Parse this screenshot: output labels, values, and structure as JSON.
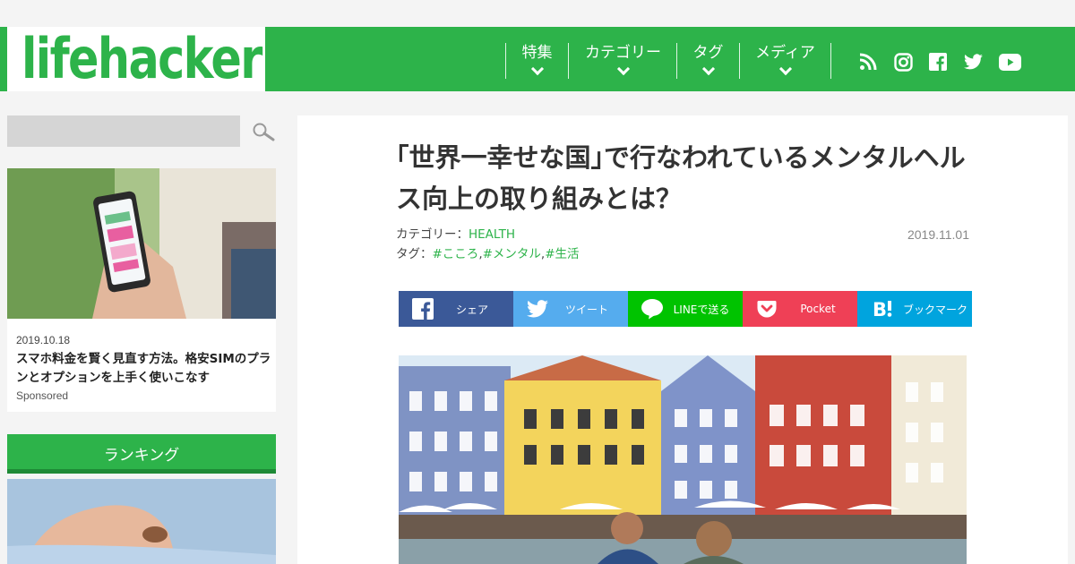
{
  "logo": "lifehacker",
  "nav": {
    "items": [
      {
        "label": "特集"
      },
      {
        "label": "カテゴリー"
      },
      {
        "label": "タグ"
      },
      {
        "label": "メディア"
      }
    ],
    "social": [
      "rss-icon",
      "instagram-icon",
      "facebook-icon",
      "twitter-icon",
      "youtube-icon"
    ]
  },
  "sidebar": {
    "search_placeholder": "",
    "promo": {
      "date": "2019.10.18",
      "title": "スマホ料金を賢く見直す方法。格安SIMのプランとオプションを上手く使いこなす",
      "sponsored": "Sponsored"
    },
    "ranking_title": "ランキング"
  },
  "article": {
    "title": "｢世界一幸せな国｣で行なわれているメンタルヘルス向上の取り組みとは？",
    "category_label": "カテゴリー：",
    "category": "HEALTH",
    "tag_label": "タグ：",
    "tags": [
      "#こころ",
      "#メンタル",
      "#生活"
    ],
    "date": "2019.11.01"
  },
  "share": [
    {
      "label": "シェア",
      "color": "#3b5998",
      "icon": "facebook-icon"
    },
    {
      "label": "ツイート",
      "color": "#55acee",
      "icon": "twitter-icon"
    },
    {
      "label": "LINEで送る",
      "color": "#00c300",
      "icon": "line-icon"
    },
    {
      "label": "Pocket",
      "color": "#ef4056",
      "icon": "pocket-icon"
    },
    {
      "label": "ブックマーク",
      "color": "#00a4de",
      "icon": "hatena-icon"
    }
  ],
  "colors": {
    "brand": "#2db34a"
  }
}
